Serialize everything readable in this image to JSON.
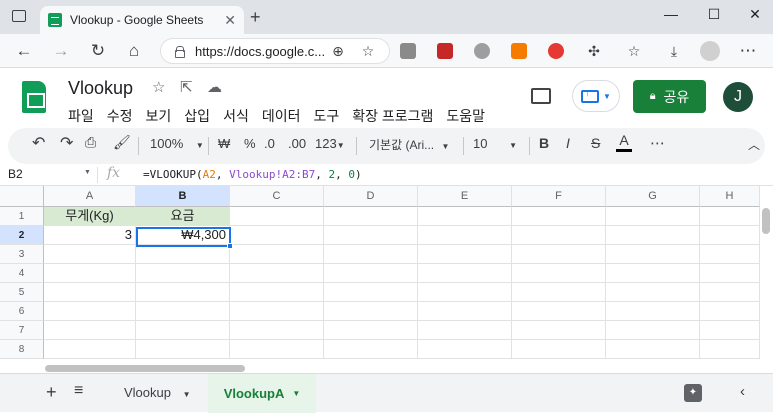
{
  "browser": {
    "tab_title": "Vlookup - Google Sheets",
    "url": "https://docs.google.c...",
    "new_tab": "+",
    "minimize": "—",
    "maximize": "☐",
    "close": "✕"
  },
  "header": {
    "title": "Vlookup",
    "share_label": "공유",
    "avatar_initial": "J"
  },
  "menu": [
    "파일",
    "수정",
    "보기",
    "삽입",
    "서식",
    "데이터",
    "도구",
    "확장 프로그램",
    "도움말"
  ],
  "toolbar": {
    "zoom": "100%",
    "currency": "₩",
    "percent": "%",
    "dec_decrease": ".0",
    "dec_increase": ".00",
    "format_more": "123",
    "font": "기본값 (Ari...",
    "font_size": "10",
    "bold": "B",
    "italic": "I",
    "strike": "S",
    "text_color": "A",
    "more": "⋯"
  },
  "formula_bar": {
    "cell_ref": "B2",
    "fx": "fx",
    "prefix": "=VLOOKUP(",
    "ref1": "A2",
    "sep1": ", ",
    "ref2": "Vlookup!A2:B7",
    "sep2": ", ",
    "col": "2",
    "sep3": ", ",
    "exact": "0",
    "suffix": ")"
  },
  "grid": {
    "columns": [
      "A",
      "B",
      "C",
      "D",
      "E",
      "F",
      "G",
      "H"
    ],
    "rows": [
      "1",
      "2",
      "3",
      "4",
      "5",
      "6",
      "7",
      "8"
    ],
    "a1": "무게(Kg)",
    "b1": "요금",
    "a2": "3",
    "b2": "₩4,300"
  },
  "sheets": {
    "tabs": [
      "Vlookup",
      "VlookupA"
    ],
    "active": "VlookupA",
    "add": "+",
    "list": "≡"
  },
  "colors": {
    "header_fill": "#d9ead3",
    "accent": "#1a73e8",
    "share_green": "#188038"
  }
}
